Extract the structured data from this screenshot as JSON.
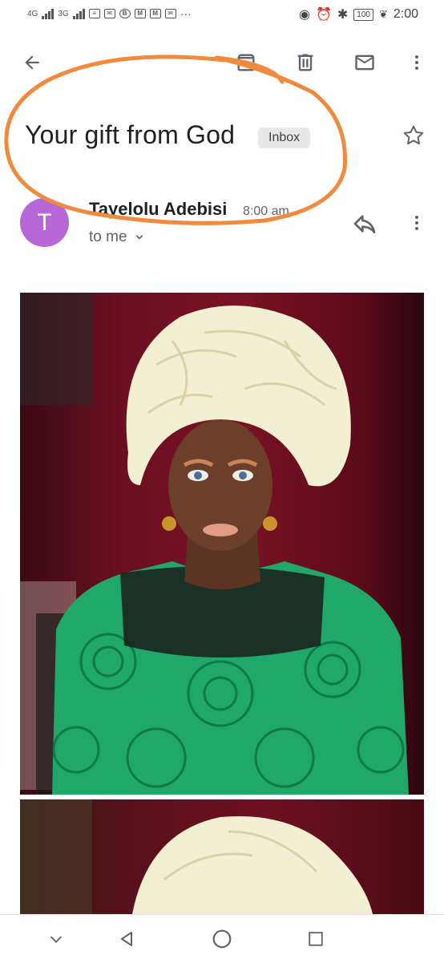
{
  "status_bar": {
    "network_1": "4G",
    "network_2": "3G",
    "battery": "100",
    "time": "2:00"
  },
  "toolbar": {
    "icons": [
      "back-arrow-icon",
      "archive-icon",
      "delete-icon",
      "mark-unread-icon",
      "more-vert-icon"
    ]
  },
  "email": {
    "subject": "Your gift from God",
    "label": "Inbox",
    "sender_initial": "T",
    "sender_name": "Tayelolu Adebisi",
    "time": "8:00 am",
    "recipient": "to me",
    "avatar_color": "#b867d6"
  },
  "colors": {
    "annotation": "#f08a3c",
    "dress": "#1fa86a",
    "headwrap": "#f3efd2",
    "backdrop": "#7a1226"
  },
  "nav_bar": {
    "icons": [
      "collapse-icon",
      "back-triangle-icon",
      "home-circle-icon",
      "recents-square-icon"
    ]
  }
}
